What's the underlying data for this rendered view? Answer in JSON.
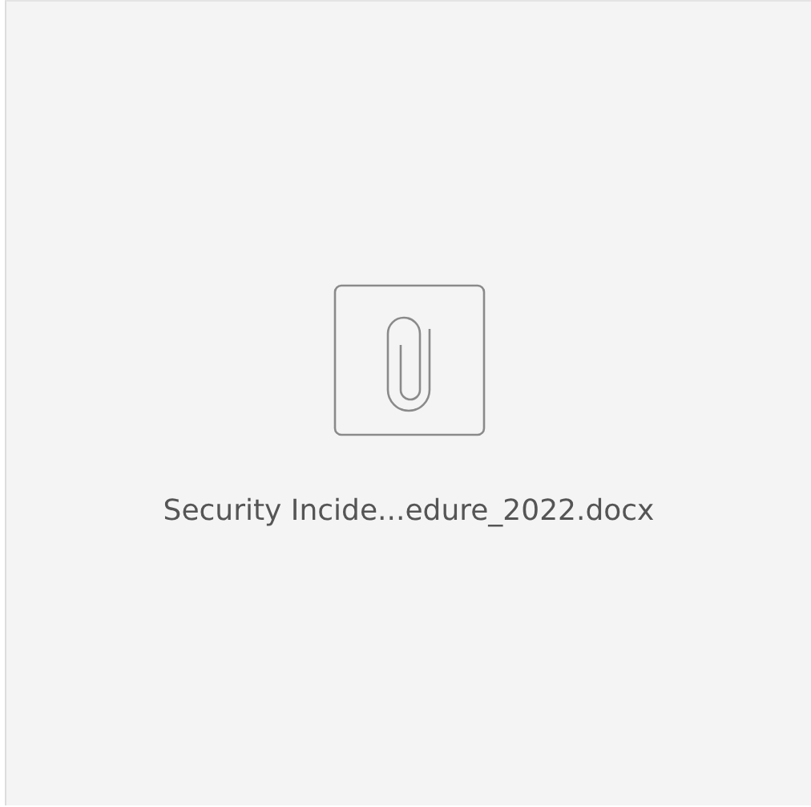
{
  "attachment": {
    "file_name": "Security Incide...edure_2022.docx"
  }
}
